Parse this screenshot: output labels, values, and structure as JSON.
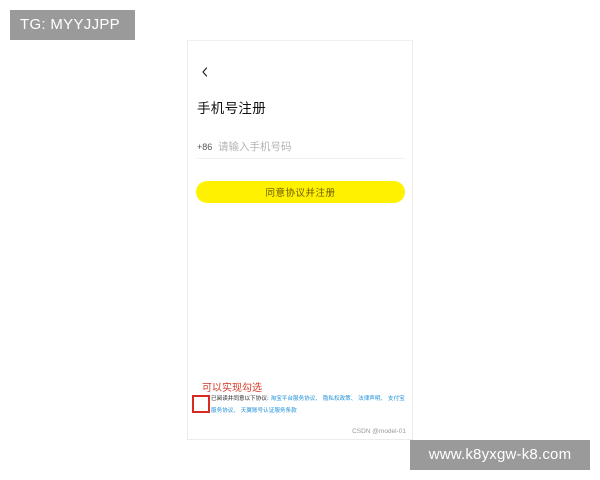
{
  "overlay": {
    "tg_label": "TG: MYYJJPP",
    "site_label": "www.k8yxgw-k8.com"
  },
  "screen": {
    "back_icon": "chevron-left-icon",
    "title": "手机号注册",
    "country_code": "+86",
    "phone_placeholder": "请输入手机号码",
    "phone_value": "",
    "register_button": "同意协议并注册",
    "annotation": "可以实现勾选",
    "agreement": {
      "checked": false,
      "prefix": "已阅读并同意以下协议:",
      "links": [
        "淘宝平台服务协议、",
        "隐私权政策、",
        "法律声明、",
        "支付宝服务协议、",
        "天翼账号认证服务条款"
      ]
    },
    "watermark": "CSDN @model-01"
  },
  "colors": {
    "register_button_bg": "#fff100",
    "link": "#1a8fd8",
    "annotation": "#d23a2a",
    "overlay_bg": "#9a9a9a"
  }
}
